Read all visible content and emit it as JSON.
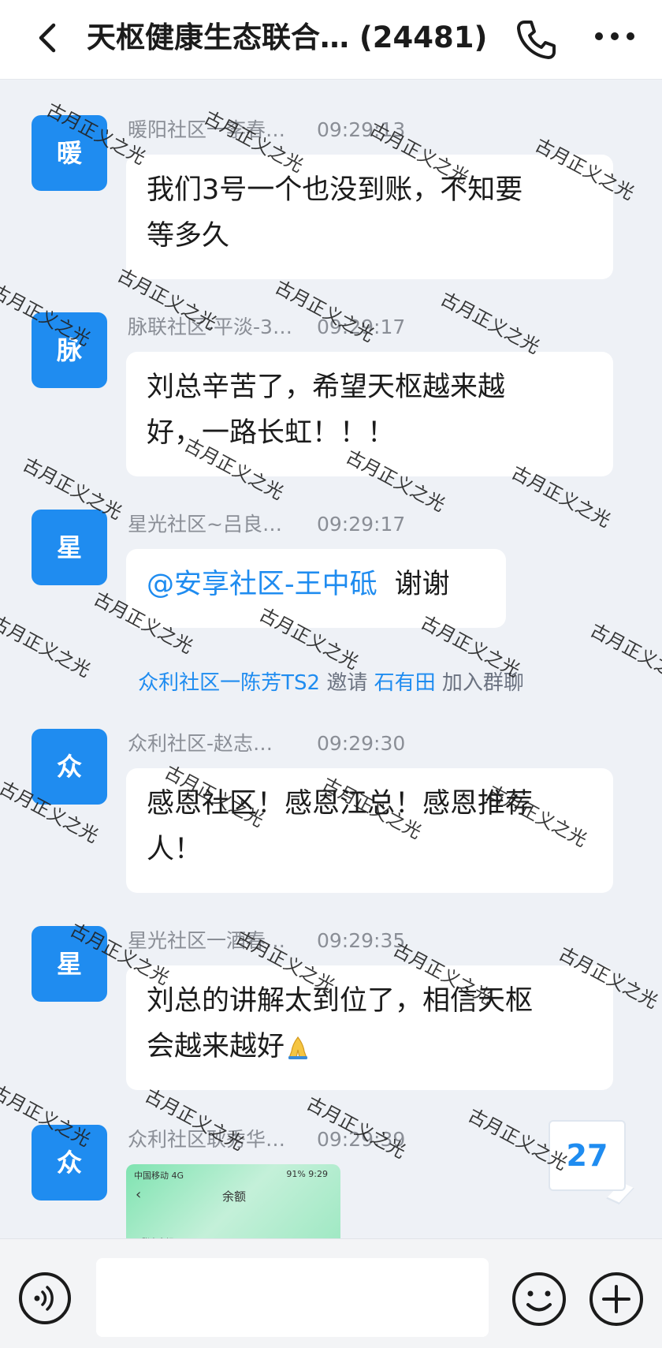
{
  "header": {
    "title": "天枢健康生态联合… (24481)"
  },
  "messages": [
    {
      "avatar": "暖",
      "sender": "暖阳社区一李春…",
      "time": "09:29:13",
      "text_lines": [
        "我们3号一个也没到账，不知要",
        "等多久"
      ]
    },
    {
      "avatar": "脉",
      "sender": "脉联社区-平淡-3…",
      "time": "09:29:17",
      "text_lines": [
        "刘总辛苦了，希望天枢越来越",
        "好，一路长虹！！！"
      ]
    },
    {
      "avatar": "星",
      "sender": "星光社区~吕良…",
      "time": "09:29:17",
      "mention": "@安享社区-王中砥",
      "text": "谢谢"
    },
    {
      "avatar": "众",
      "sender": "众利社区-赵志…",
      "time": "09:29:30",
      "text_lines": [
        "感恩社区！感恩江总！感恩推荐",
        "人！"
      ]
    },
    {
      "avatar": "星",
      "sender": "星光社区一酒春…",
      "time": "09:29:35",
      "text_lines": [
        "刘总的讲解太到位了，相信天枢",
        "会越来越好"
      ]
    },
    {
      "avatar": "众",
      "sender": "众利社区耿秀华…",
      "time": "09:29:39",
      "image": {
        "status_left": "中国移动 4G",
        "status_right": "91% 9:29",
        "title": "余额",
        "label": "账户余额"
      }
    }
  ],
  "system_notice": {
    "inviter": "众利社区一陈芳TS2",
    "verb": "邀请",
    "invitee": "石有田",
    "suffix": "加入群聊"
  },
  "unread_count": "27",
  "composer": {
    "placeholder": ""
  },
  "watermark": "古月正义之光",
  "icons": [
    "back-arrow-icon",
    "phone-icon",
    "more-dots-icon",
    "voice-icon",
    "emoji-icon",
    "plus-icon"
  ],
  "colors": {
    "accent": "#1f8cf0",
    "background": "#eef1f6",
    "bubble": "#ffffff"
  }
}
